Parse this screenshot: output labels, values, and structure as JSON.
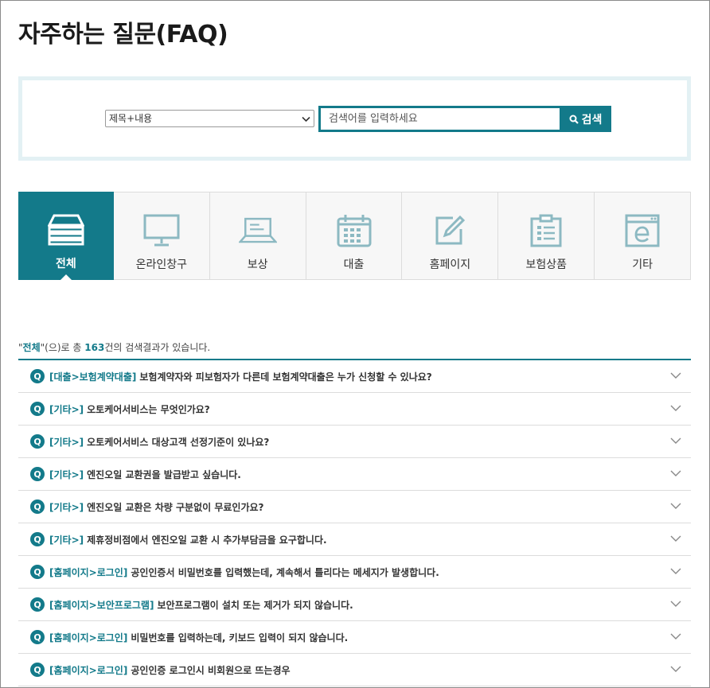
{
  "page": {
    "title": "자주하는 질문(FAQ)"
  },
  "search": {
    "select_value": "제목+내용",
    "input_placeholder": "검색어를 입력하세요",
    "button_label": "검색"
  },
  "tabs": [
    {
      "label": "전체",
      "icon": "stack-icon",
      "active": true
    },
    {
      "label": "온라인창구",
      "icon": "monitor-icon",
      "active": false
    },
    {
      "label": "보상",
      "icon": "laptop-icon",
      "active": false
    },
    {
      "label": "대출",
      "icon": "calendar-icon",
      "active": false
    },
    {
      "label": "홈페이지",
      "icon": "edit-icon",
      "active": false
    },
    {
      "label": "보험상품",
      "icon": "clipboard-icon",
      "active": false
    },
    {
      "label": "기타",
      "icon": "browser-e-icon",
      "active": false
    }
  ],
  "summary": {
    "quote_open": "\"",
    "category": "전체",
    "mid": "\"(으)로 총 ",
    "count": "163",
    "suffix": "건의 검색결과가 있습니다."
  },
  "faq_badge": "Q",
  "faqs": [
    {
      "category": "[대출>보험계약대출]",
      "question": "보험계약자와 피보험자가 다른데 보험계약대출은 누가 신청할 수 있나요?"
    },
    {
      "category": "[기타>]",
      "question": "오토케어서비스는 무엇인가요?"
    },
    {
      "category": "[기타>]",
      "question": "오토케어서비스 대상고객 선정기준이 있나요?"
    },
    {
      "category": "[기타>]",
      "question": "엔진오일 교환권을 발급받고 싶습니다."
    },
    {
      "category": "[기타>]",
      "question": "엔진오일 교환은 차량 구분없이 무료인가요?"
    },
    {
      "category": "[기타>]",
      "question": "제휴정비점에서 엔진오일 교환 시 추가부담금을 요구합니다."
    },
    {
      "category": "[홈페이지>로그인]",
      "question": "공인인증서 비밀번호를 입력했는데, 계속해서 틀리다는 메세지가 발생합니다."
    },
    {
      "category": "[홈페이지>보안프로그램]",
      "question": "보안프로그램이 설치 또는 제거가 되지 않습니다."
    },
    {
      "category": "[홈페이지>로그인]",
      "question": "비밀번호를 입력하는데, 키보드 입력이 되지 않습니다."
    },
    {
      "category": "[홈페이지>로그인]",
      "question": "공인인증 로그인시 비회원으로 뜨는경우"
    }
  ],
  "colors": {
    "accent": "#137a8a",
    "icon_stroke": "#8cb9c2",
    "tab_bg": "#f7f7f7"
  }
}
